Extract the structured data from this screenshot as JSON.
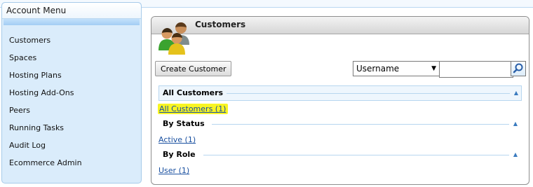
{
  "sidebar": {
    "title": "Account Menu",
    "items": [
      {
        "label": "Customers"
      },
      {
        "label": "Spaces"
      },
      {
        "label": "Hosting Plans"
      },
      {
        "label": "Hosting Add-Ons"
      },
      {
        "label": "Peers"
      },
      {
        "label": "Running Tasks"
      },
      {
        "label": "Audit Log"
      },
      {
        "label": "Ecommerce Admin"
      }
    ]
  },
  "panel": {
    "title": "Customers",
    "icon": "customers-group-icon",
    "create_button": "Create Customer",
    "search": {
      "field_selected": "Username",
      "value": "",
      "button_icon": "magnifier-icon"
    },
    "groups": {
      "all": {
        "heading": "All Customers",
        "link": "All Customers (1)"
      },
      "status": {
        "heading": "By Status",
        "link": "Active (1)"
      },
      "role": {
        "heading": "By Role",
        "link": "User (1)"
      }
    }
  },
  "colors": {
    "highlight": "#f8f523",
    "link": "#1a50a0",
    "sidebar_bg": "#daecfb"
  }
}
